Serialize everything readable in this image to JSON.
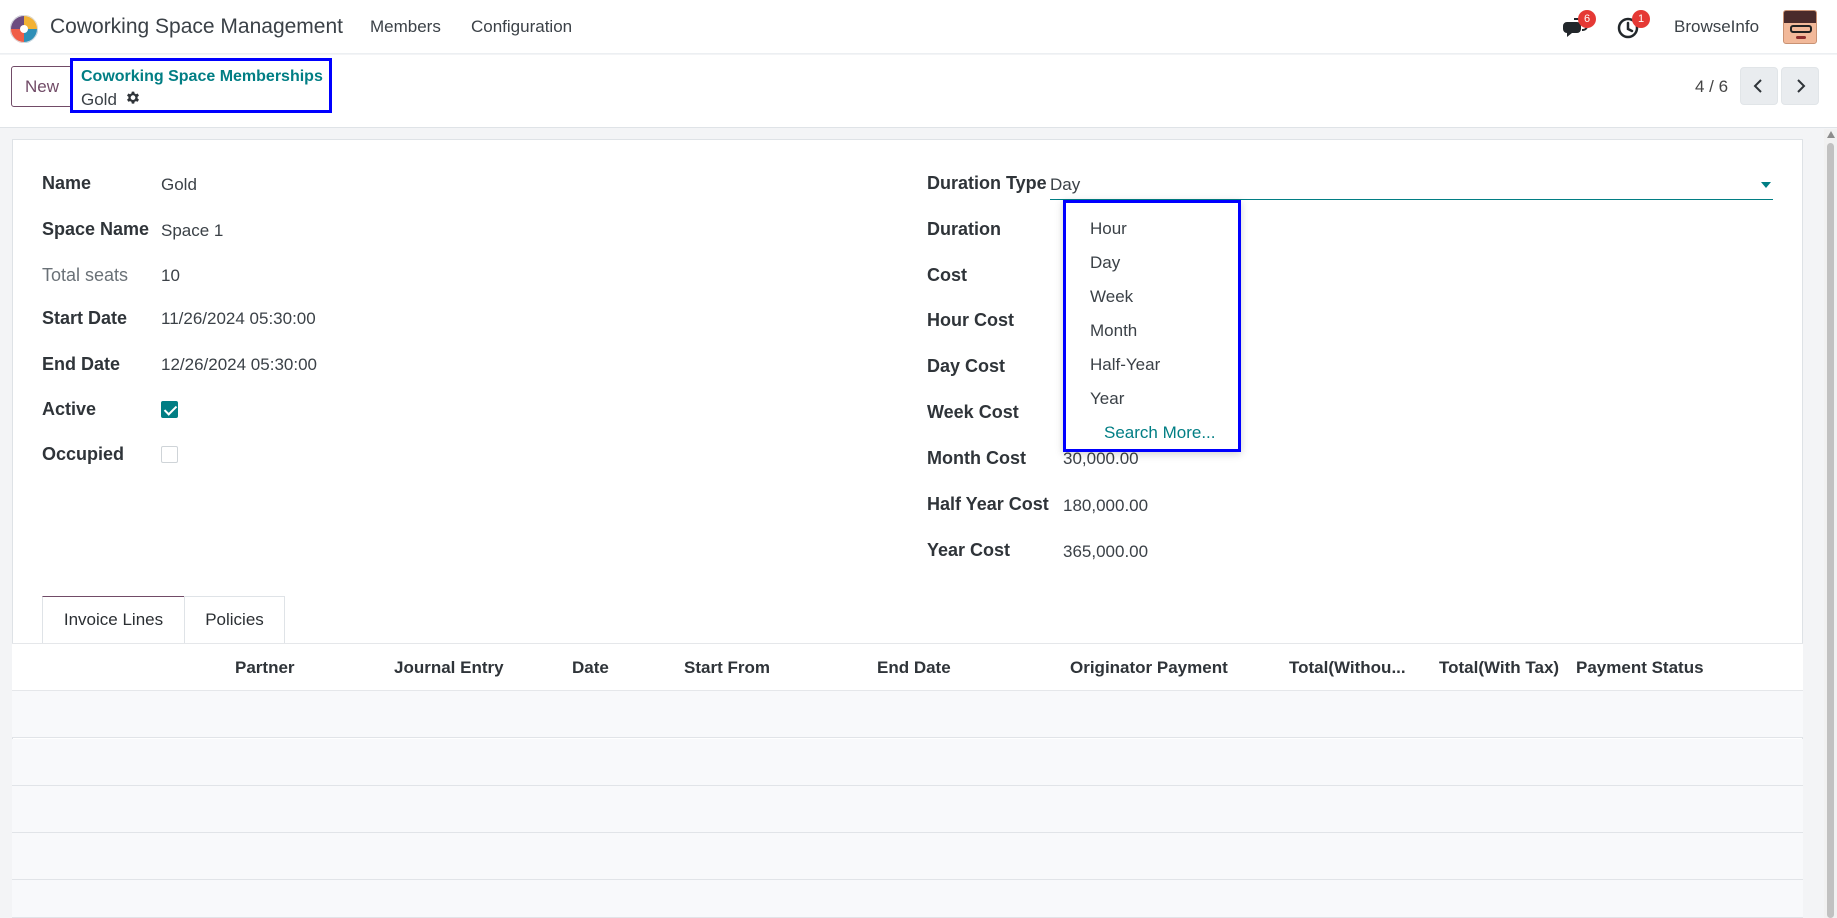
{
  "app": {
    "title": "Coworking Space Management",
    "nav": [
      "Members",
      "Configuration"
    ],
    "company": "BrowseInfo",
    "badges": {
      "chat": "6",
      "activity": "1"
    }
  },
  "control": {
    "new_label": "New",
    "breadcrumb_root": "Coworking Space Memberships",
    "breadcrumb_current": "Gold",
    "pager": "4 / 6"
  },
  "form": {
    "left": {
      "name_label": "Name",
      "name_value": "Gold",
      "space_label": "Space Name",
      "space_value": "Space 1",
      "seats_label": "Total seats",
      "seats_value": "10",
      "start_label": "Start Date",
      "start_value": "11/26/2024 05:30:00",
      "end_label": "End Date",
      "end_value": "12/26/2024 05:30:00",
      "active_label": "Active",
      "occupied_label": "Occupied"
    },
    "right": {
      "duration_type_label": "Duration Type",
      "duration_type_value": "Day",
      "duration_label": "Duration",
      "cost_label": "Cost",
      "hour_cost_label": "Hour Cost",
      "day_cost_label": "Day Cost",
      "week_cost_label": "Week Cost",
      "month_cost_label": "Month Cost",
      "month_cost_value": "30,000.00",
      "half_year_cost_label": "Half Year Cost",
      "half_year_cost_value": "180,000.00",
      "year_cost_label": "Year Cost",
      "year_cost_value": "365,000.00"
    },
    "dropdown": [
      "Hour",
      "Day",
      "Week",
      "Month",
      "Half-Year",
      "Year",
      "Search More..."
    ]
  },
  "tabs": [
    "Invoice Lines",
    "Policies"
  ],
  "table": {
    "headers": [
      "Partner",
      "Journal Entry",
      "Date",
      "Start From",
      "End Date",
      "Originator Payment",
      "Total(Withou...",
      "Total(With Tax)",
      "Payment Status"
    ]
  },
  "colors": {
    "accent": "#017e84",
    "purple": "#714b67",
    "highlight": "#0000ff",
    "badge": "#e53935"
  }
}
